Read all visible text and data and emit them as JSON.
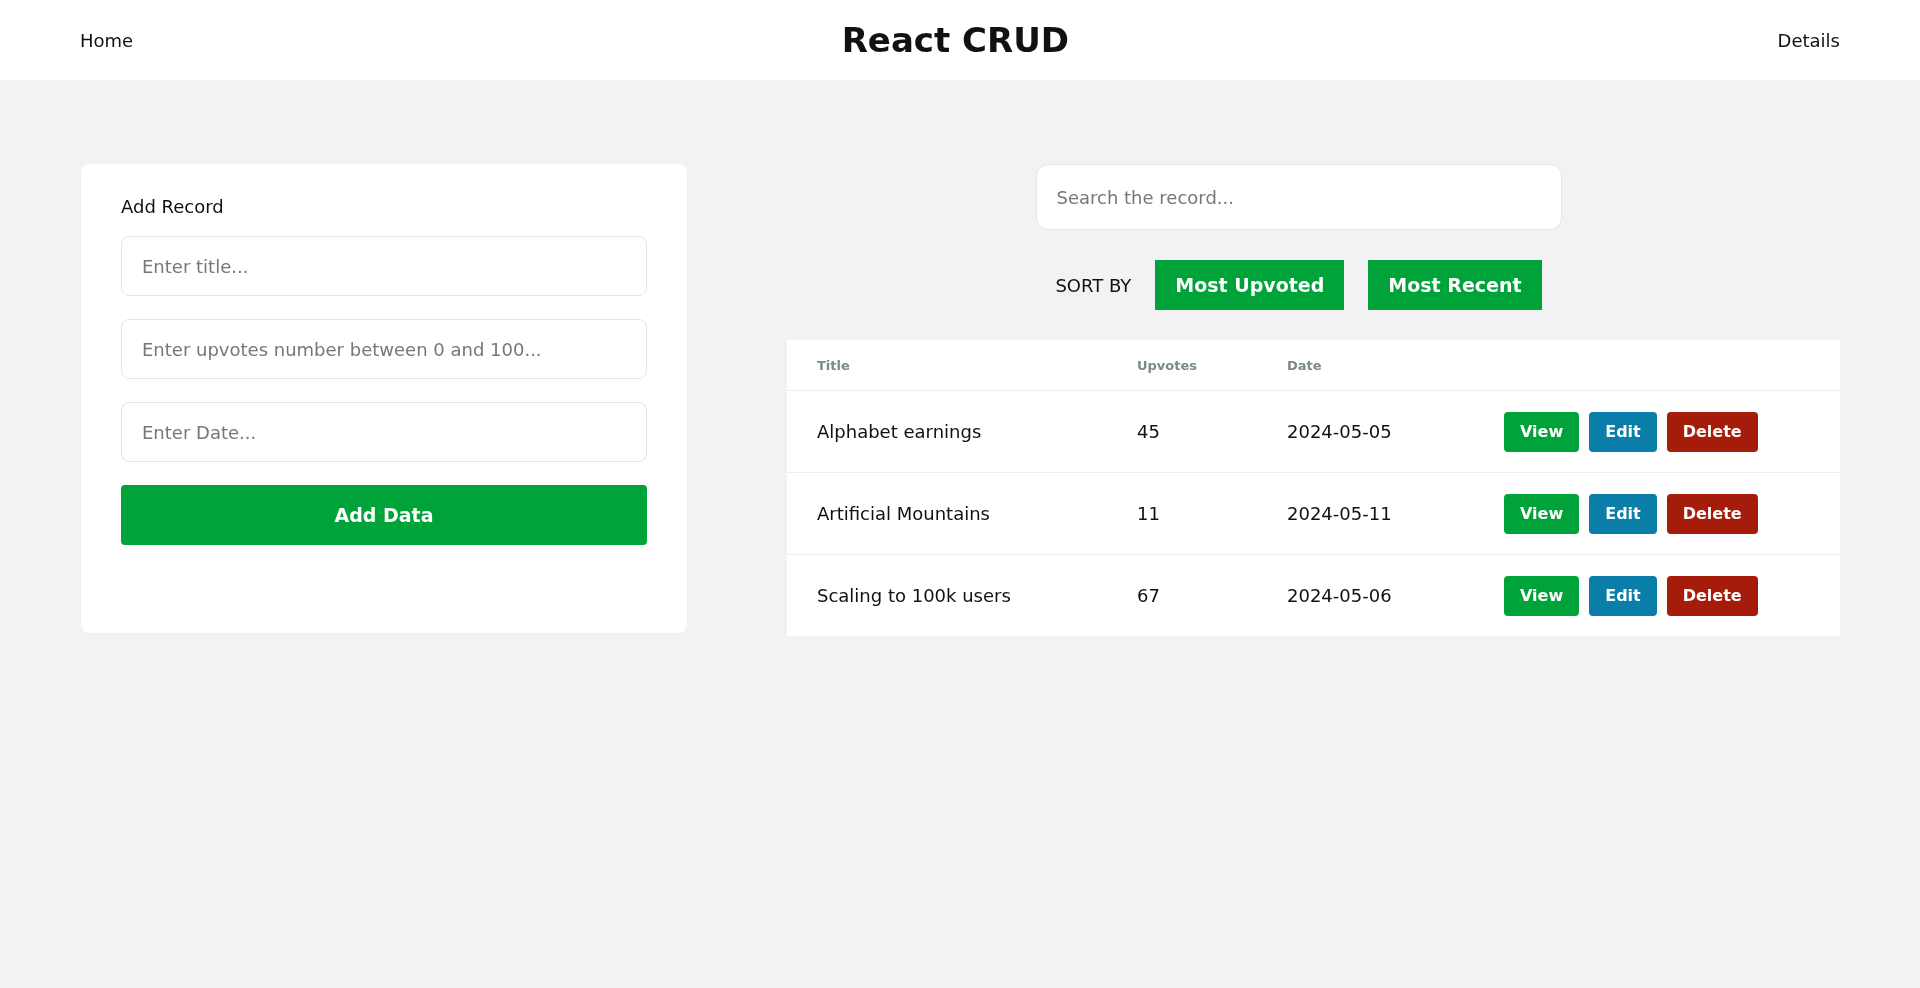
{
  "nav": {
    "home": "Home",
    "title": "React CRUD",
    "details": "Details"
  },
  "form": {
    "heading": "Add Record",
    "fields": [
      {
        "placeholder": "Enter title..."
      },
      {
        "placeholder": "Enter upvotes number between 0 and 100..."
      },
      {
        "placeholder": "Enter Date..."
      }
    ],
    "submit": "Add Data"
  },
  "search": {
    "placeholder": "Search the record..."
  },
  "sort": {
    "label": "SORT BY",
    "buttons": [
      "Most Upvoted",
      "Most Recent"
    ]
  },
  "table": {
    "columns": [
      "Title",
      "Upvotes",
      "Date"
    ],
    "rows": [
      {
        "title": "Alphabet earnings",
        "upvotes": "45",
        "date": "2024-05-05",
        "actions": [
          {
            "kind": "view",
            "label": "View"
          },
          {
            "kind": "edit",
            "label": "Edit"
          },
          {
            "kind": "delete",
            "label": "Delete"
          }
        ]
      },
      {
        "title": "Artificial Mountains",
        "upvotes": "11",
        "date": "2024-05-11",
        "actions": [
          {
            "kind": "view",
            "label": "View"
          },
          {
            "kind": "edit",
            "label": "Edit"
          },
          {
            "kind": "delete",
            "label": "Delete"
          }
        ]
      },
      {
        "title": "Scaling to 100k users",
        "upvotes": "67",
        "date": "2024-05-06",
        "actions": [
          {
            "kind": "view",
            "label": "View"
          },
          {
            "kind": "edit",
            "label": "Edit"
          },
          {
            "kind": "delete",
            "label": "Delete"
          }
        ]
      }
    ]
  }
}
